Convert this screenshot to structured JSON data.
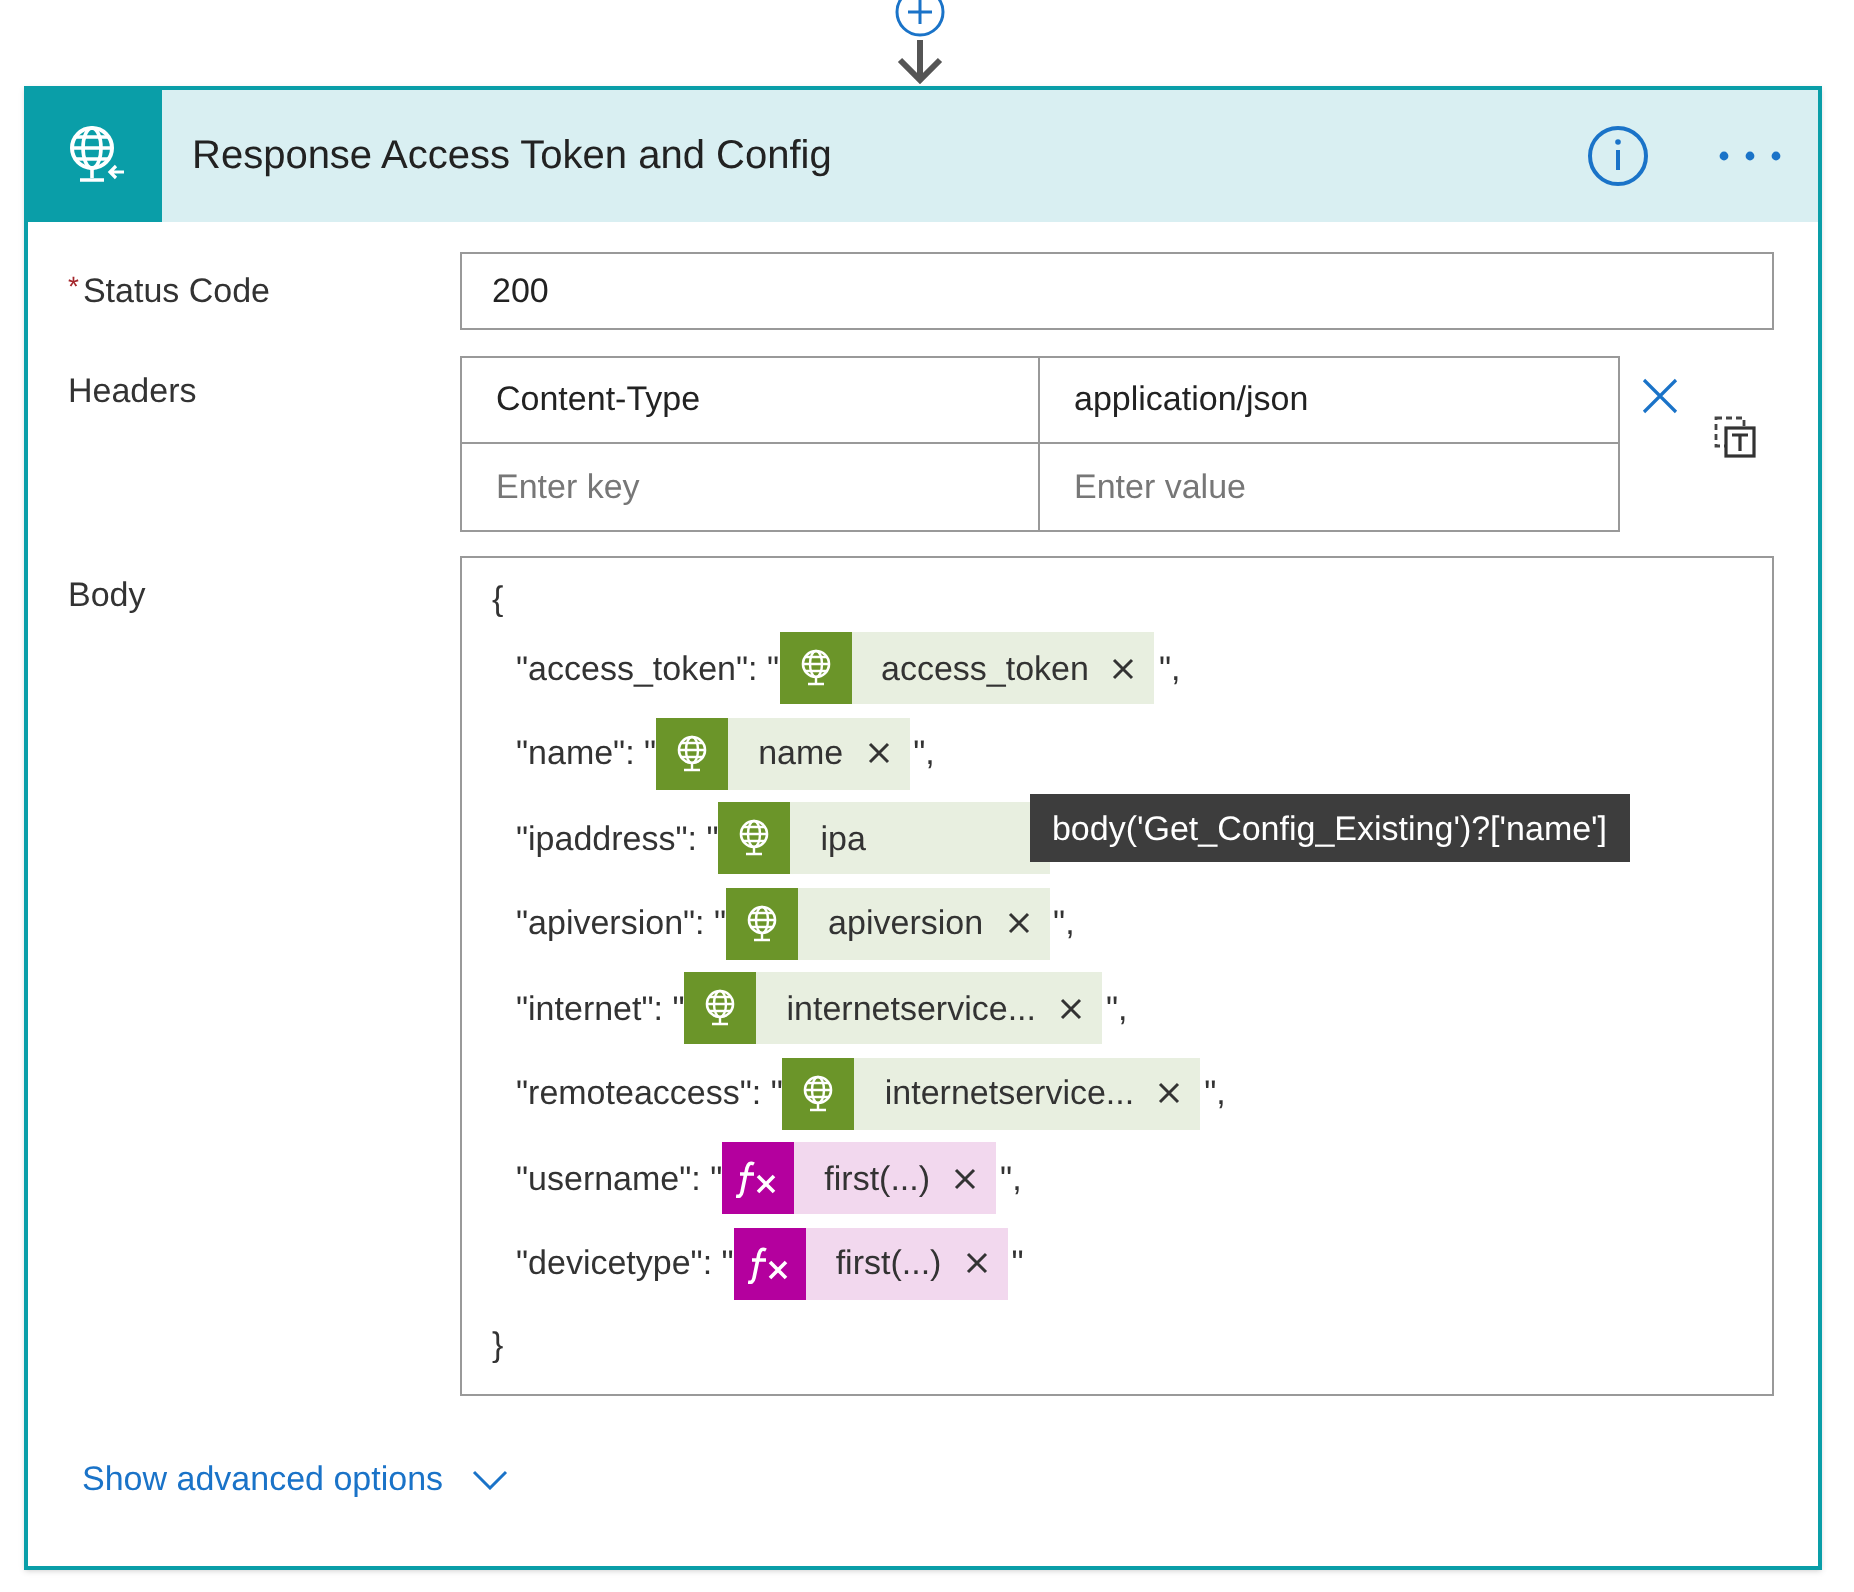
{
  "card": {
    "title": "Response Access Token and Config"
  },
  "status_code": {
    "label": "Status Code",
    "required_mark": "*",
    "value": "200"
  },
  "headers": {
    "label": "Headers",
    "rows": [
      {
        "key": "Content-Type",
        "value": "application/json"
      }
    ],
    "key_placeholder": "Enter key",
    "value_placeholder": "Enter value"
  },
  "body": {
    "label": "Body",
    "open": "{",
    "close": "}",
    "lines": [
      {
        "prefix": "\"access_token\": \"",
        "token": {
          "kind": "dynamic",
          "label": "access_token",
          "removable": true
        },
        "suffix": "\","
      },
      {
        "prefix": "\"name\": \"",
        "token": {
          "kind": "dynamic",
          "label": "name",
          "removable": true
        },
        "suffix": "\","
      },
      {
        "prefix": "\"ipaddress\": \"",
        "token": {
          "kind": "dynamic",
          "label": "ipa",
          "removable": false
        },
        "tooltip": "body('Get_Config_Existing')?['name']"
      },
      {
        "prefix": "\"apiversion\": \"",
        "token": {
          "kind": "dynamic",
          "label": "apiversion",
          "removable": true
        },
        "suffix": "\","
      },
      {
        "prefix": "\"internet\": \"",
        "token": {
          "kind": "dynamic",
          "label": "internetservice...",
          "removable": true
        },
        "suffix": "\","
      },
      {
        "prefix": "\"remoteaccess\": \"",
        "token": {
          "kind": "dynamic",
          "label": "internetservice...",
          "removable": true
        },
        "suffix": "\","
      },
      {
        "prefix": "\"username\": \"",
        "token": {
          "kind": "expression",
          "label": "first(...)",
          "removable": true
        },
        "suffix": "\","
      },
      {
        "prefix": "\"devicetype\": \"",
        "token": {
          "kind": "expression",
          "label": "first(...)",
          "removable": true
        },
        "suffix": "\""
      }
    ]
  },
  "advanced": {
    "label": "Show advanced options"
  }
}
